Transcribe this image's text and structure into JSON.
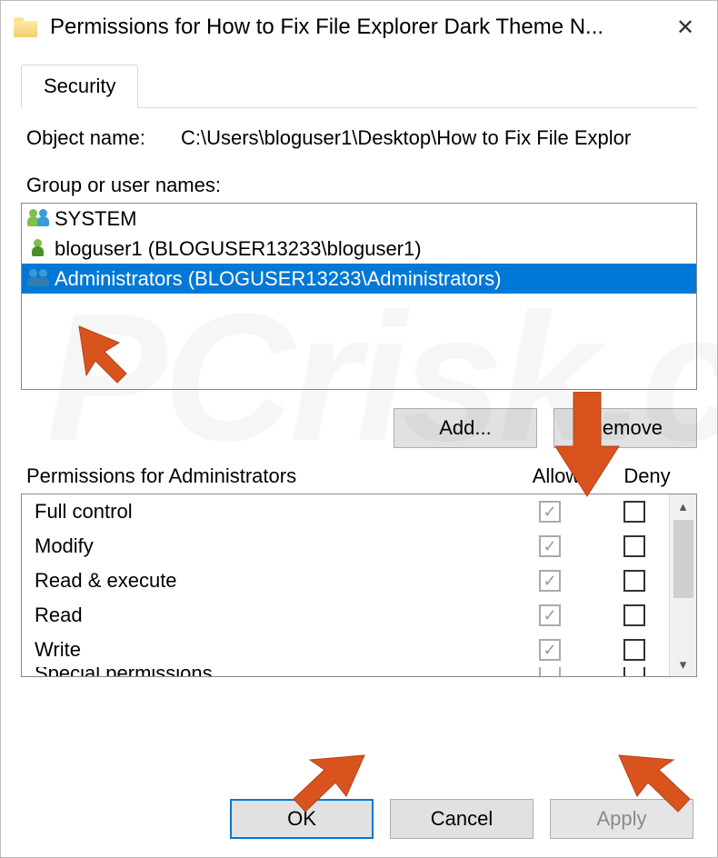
{
  "window": {
    "title": "Permissions for How to Fix File Explorer Dark Theme N...",
    "close_glyph": "✕"
  },
  "tabs": {
    "security": "Security"
  },
  "object": {
    "label": "Object name:",
    "path": "C:\\Users\\bloguser1\\Desktop\\How to Fix File Explor"
  },
  "groups": {
    "label": "Group or user names:",
    "items": [
      {
        "icon": "system",
        "text": "SYSTEM",
        "selected": false
      },
      {
        "icon": "user",
        "text": "bloguser1 (BLOGUSER13233\\bloguser1)",
        "selected": false
      },
      {
        "icon": "admins",
        "text": "Administrators (BLOGUSER13233\\Administrators)",
        "selected": true
      }
    ]
  },
  "buttons": {
    "add": "Add...",
    "remove": "Remove",
    "ok": "OK",
    "cancel": "Cancel",
    "apply": "Apply"
  },
  "perms": {
    "header_label": "Permissions for Administrators",
    "allow": "Allow",
    "deny": "Deny",
    "rows": [
      {
        "name": "Full control",
        "allow": true,
        "deny": false
      },
      {
        "name": "Modify",
        "allow": true,
        "deny": false
      },
      {
        "name": "Read & execute",
        "allow": true,
        "deny": false
      },
      {
        "name": "Read",
        "allow": true,
        "deny": false
      },
      {
        "name": "Write",
        "allow": true,
        "deny": false
      },
      {
        "name": "Special permissions",
        "allow": false,
        "deny": false
      }
    ]
  },
  "watermark": "PCrisk.com"
}
